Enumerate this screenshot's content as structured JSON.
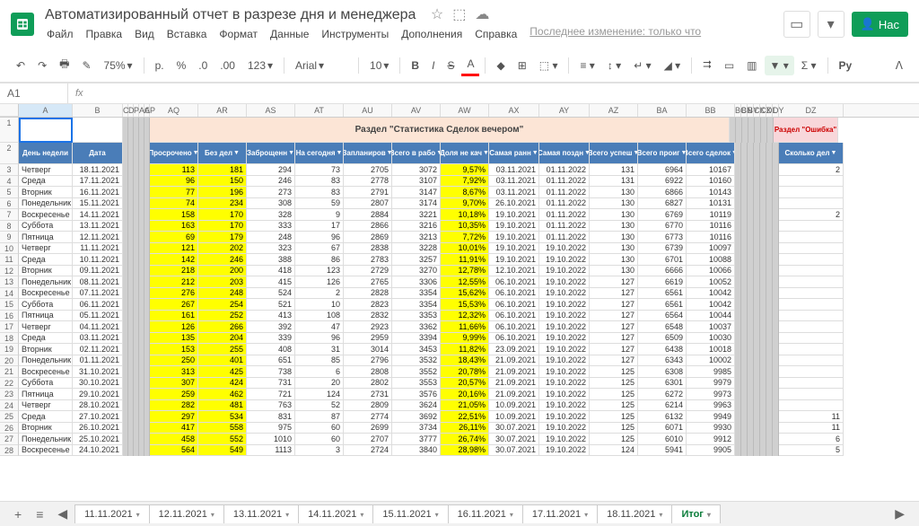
{
  "doc": {
    "title": "Автоматизированный отчет в разрезе дня и менеджера",
    "last_modified": "Последнее изменение: только что"
  },
  "menus": [
    "Файл",
    "Правка",
    "Вид",
    "Вставка",
    "Формат",
    "Данные",
    "Инструменты",
    "Дополнения",
    "Справка"
  ],
  "toolbar": {
    "zoom": "75%",
    "currency": "р.",
    "percent": "%",
    "decimals_dec": ".0",
    "decimals_inc": ".00",
    "format": "123",
    "font": "Arial",
    "fontsize": "10"
  },
  "cell_reference": "A1",
  "share": "Нас",
  "section_header": "Раздел \"Статистика Сделок вечером\"",
  "error_header": "Раздел \"Ошибка\"",
  "columns": {
    "A": "День недели",
    "B": "Дата",
    "AQ": "Просрочено",
    "AR": "Без дел",
    "AS": "Заброщенн",
    "AT": "На сегодня",
    "AU": "Запланиров",
    "AV": "Всего в рабо",
    "AW": "Доля не кач",
    "AX": "Самая ранн",
    "AY": "Самая поздн",
    "AZ": "Всего успеш",
    "BA": "Всего проиг",
    "BB": "Всего сделок",
    "DZ": "Сколько дел"
  },
  "col_letters_small": [
    "C",
    "D",
    "P",
    "AC",
    "AP"
  ],
  "col_letters_small2": [
    "BC",
    "BN",
    "BY",
    "CK",
    "CX",
    "DL",
    "DY"
  ],
  "rows": [
    {
      "n": 3,
      "day": "Четверг",
      "date": "18.11.2021",
      "aq": 113,
      "ar": 181,
      "as": 294,
      "at": 73,
      "au": 2705,
      "av": 3072,
      "aw": "9,57%",
      "ax": "03.11.2021",
      "ay": "01.11.2022",
      "az": 131,
      "ba": 6964,
      "bb": 10167,
      "dz": 2
    },
    {
      "n": 4,
      "day": "Среда",
      "date": "17.11.2021",
      "aq": 96,
      "ar": 150,
      "as": 246,
      "at": 83,
      "au": 2778,
      "av": 3107,
      "aw": "7,92%",
      "ax": "03.11.2021",
      "ay": "01.11.2022",
      "az": 131,
      "ba": 6922,
      "bb": 10160,
      "dz": ""
    },
    {
      "n": 5,
      "day": "Вторник",
      "date": "16.11.2021",
      "aq": 77,
      "ar": 196,
      "as": 273,
      "at": 83,
      "au": 2791,
      "av": 3147,
      "aw": "8,67%",
      "ax": "03.11.2021",
      "ay": "01.11.2022",
      "az": 130,
      "ba": 6866,
      "bb": 10143,
      "dz": ""
    },
    {
      "n": 6,
      "day": "Понедельник",
      "date": "15.11.2021",
      "aq": 74,
      "ar": 234,
      "as": 308,
      "at": 59,
      "au": 2807,
      "av": 3174,
      "aw": "9,70%",
      "ax": "26.10.2021",
      "ay": "01.11.2022",
      "az": 130,
      "ba": 6827,
      "bb": 10131,
      "dz": ""
    },
    {
      "n": 7,
      "day": "Воскресенье",
      "date": "14.11.2021",
      "aq": 158,
      "ar": 170,
      "as": 328,
      "at": 9,
      "au": 2884,
      "av": 3221,
      "aw": "10,18%",
      "ax": "19.10.2021",
      "ay": "01.11.2022",
      "az": 130,
      "ba": 6769,
      "bb": 10119,
      "dz": 2
    },
    {
      "n": 8,
      "day": "Суббота",
      "date": "13.11.2021",
      "aq": 163,
      "ar": 170,
      "as": 333,
      "at": 17,
      "au": 2866,
      "av": 3216,
      "aw": "10,35%",
      "ax": "19.10.2021",
      "ay": "01.11.2022",
      "az": 130,
      "ba": 6770,
      "bb": 10116,
      "dz": ""
    },
    {
      "n": 9,
      "day": "Пятница",
      "date": "12.11.2021",
      "aq": 69,
      "ar": 179,
      "as": 248,
      "at": 96,
      "au": 2869,
      "av": 3213,
      "aw": "7,72%",
      "ax": "19.10.2021",
      "ay": "01.11.2022",
      "az": 130,
      "ba": 6773,
      "bb": 10116,
      "dz": ""
    },
    {
      "n": 10,
      "day": "Четверг",
      "date": "11.11.2021",
      "aq": 121,
      "ar": 202,
      "as": 323,
      "at": 67,
      "au": 2838,
      "av": 3228,
      "aw": "10,01%",
      "ax": "19.10.2021",
      "ay": "19.10.2022",
      "az": 130,
      "ba": 6739,
      "bb": 10097,
      "dz": ""
    },
    {
      "n": 11,
      "day": "Среда",
      "date": "10.11.2021",
      "aq": 142,
      "ar": 246,
      "as": 388,
      "at": 86,
      "au": 2783,
      "av": 3257,
      "aw": "11,91%",
      "ax": "19.10.2021",
      "ay": "19.10.2022",
      "az": 130,
      "ba": 6701,
      "bb": 10088,
      "dz": ""
    },
    {
      "n": 12,
      "day": "Вторник",
      "date": "09.11.2021",
      "aq": 218,
      "ar": 200,
      "as": 418,
      "at": 123,
      "au": 2729,
      "av": 3270,
      "aw": "12,78%",
      "ax": "12.10.2021",
      "ay": "19.10.2022",
      "az": 130,
      "ba": 6666,
      "bb": 10066,
      "dz": ""
    },
    {
      "n": 13,
      "day": "Понедельник",
      "date": "08.11.2021",
      "aq": 212,
      "ar": 203,
      "as": 415,
      "at": 126,
      "au": 2765,
      "av": 3306,
      "aw": "12,55%",
      "ax": "06.10.2021",
      "ay": "19.10.2022",
      "az": 127,
      "ba": 6619,
      "bb": 10052,
      "dz": ""
    },
    {
      "n": 14,
      "day": "Воскресенье",
      "date": "07.11.2021",
      "aq": 276,
      "ar": 248,
      "as": 524,
      "at": 2,
      "au": 2828,
      "av": 3354,
      "aw": "15,62%",
      "ax": "06.10.2021",
      "ay": "19.10.2022",
      "az": 127,
      "ba": 6561,
      "bb": 10042,
      "dz": ""
    },
    {
      "n": 15,
      "day": "Суббота",
      "date": "06.11.2021",
      "aq": 267,
      "ar": 254,
      "as": 521,
      "at": 10,
      "au": 2823,
      "av": 3354,
      "aw": "15,53%",
      "ax": "06.10.2021",
      "ay": "19.10.2022",
      "az": 127,
      "ba": 6561,
      "bb": 10042,
      "dz": ""
    },
    {
      "n": 16,
      "day": "Пятница",
      "date": "05.11.2021",
      "aq": 161,
      "ar": 252,
      "as": 413,
      "at": 108,
      "au": 2832,
      "av": 3353,
      "aw": "12,32%",
      "ax": "06.10.2021",
      "ay": "19.10.2022",
      "az": 127,
      "ba": 6564,
      "bb": 10044,
      "dz": ""
    },
    {
      "n": 17,
      "day": "Четверг",
      "date": "04.11.2021",
      "aq": 126,
      "ar": 266,
      "as": 392,
      "at": 47,
      "au": 2923,
      "av": 3362,
      "aw": "11,66%",
      "ax": "06.10.2021",
      "ay": "19.10.2022",
      "az": 127,
      "ba": 6548,
      "bb": 10037,
      "dz": ""
    },
    {
      "n": 18,
      "day": "Среда",
      "date": "03.11.2021",
      "aq": 135,
      "ar": 204,
      "as": 339,
      "at": 96,
      "au": 2959,
      "av": 3394,
      "aw": "9,99%",
      "ax": "06.10.2021",
      "ay": "19.10.2022",
      "az": 127,
      "ba": 6509,
      "bb": 10030,
      "dz": ""
    },
    {
      "n": 19,
      "day": "Вторник",
      "date": "02.11.2021",
      "aq": 153,
      "ar": 255,
      "as": 408,
      "at": 31,
      "au": 3014,
      "av": 3453,
      "aw": "11,82%",
      "ax": "23.09.2021",
      "ay": "19.10.2022",
      "az": 127,
      "ba": 6438,
      "bb": 10018,
      "dz": ""
    },
    {
      "n": 20,
      "day": "Понедельник",
      "date": "01.11.2021",
      "aq": 250,
      "ar": 401,
      "as": 651,
      "at": 85,
      "au": 2796,
      "av": 3532,
      "aw": "18,43%",
      "ax": "21.09.2021",
      "ay": "19.10.2022",
      "az": 127,
      "ba": 6343,
      "bb": 10002,
      "dz": ""
    },
    {
      "n": 21,
      "day": "Воскресенье",
      "date": "31.10.2021",
      "aq": 313,
      "ar": 425,
      "as": 738,
      "at": 6,
      "au": 2808,
      "av": 3552,
      "aw": "20,78%",
      "ax": "21.09.2021",
      "ay": "19.10.2022",
      "az": 125,
      "ba": 6308,
      "bb": 9985,
      "dz": ""
    },
    {
      "n": 22,
      "day": "Суббота",
      "date": "30.10.2021",
      "aq": 307,
      "ar": 424,
      "as": 731,
      "at": 20,
      "au": 2802,
      "av": 3553,
      "aw": "20,57%",
      "ax": "21.09.2021",
      "ay": "19.10.2022",
      "az": 125,
      "ba": 6301,
      "bb": 9979,
      "dz": ""
    },
    {
      "n": 23,
      "day": "Пятница",
      "date": "29.10.2021",
      "aq": 259,
      "ar": 462,
      "as": 721,
      "at": 124,
      "au": 2731,
      "av": 3576,
      "aw": "20,16%",
      "ax": "21.09.2021",
      "ay": "19.10.2022",
      "az": 125,
      "ba": 6272,
      "bb": 9973,
      "dz": ""
    },
    {
      "n": 24,
      "day": "Четверг",
      "date": "28.10.2021",
      "aq": 282,
      "ar": 481,
      "as": 763,
      "at": 52,
      "au": 2809,
      "av": 3624,
      "aw": "21,05%",
      "ax": "10.09.2021",
      "ay": "19.10.2022",
      "az": 125,
      "ba": 6214,
      "bb": 9963,
      "dz": ""
    },
    {
      "n": 25,
      "day": "Среда",
      "date": "27.10.2021",
      "aq": 297,
      "ar": 534,
      "as": 831,
      "at": 87,
      "au": 2774,
      "av": 3692,
      "aw": "22,51%",
      "ax": "10.09.2021",
      "ay": "19.10.2022",
      "az": 125,
      "ba": 6132,
      "bb": 9949,
      "dz": 11
    },
    {
      "n": 26,
      "day": "Вторник",
      "date": "26.10.2021",
      "aq": 417,
      "ar": 558,
      "as": 975,
      "at": 60,
      "au": 2699,
      "av": 3734,
      "aw": "26,11%",
      "ax": "30.07.2021",
      "ay": "19.10.2022",
      "az": 125,
      "ba": 6071,
      "bb": 9930,
      "dz": 11
    },
    {
      "n": 27,
      "day": "Понедельник",
      "date": "25.10.2021",
      "aq": 458,
      "ar": 552,
      "as": 1010,
      "at": 60,
      "au": 2707,
      "av": 3777,
      "aw": "26,74%",
      "ax": "30.07.2021",
      "ay": "19.10.2022",
      "az": 125,
      "ba": 6010,
      "bb": 9912,
      "dz": 6
    },
    {
      "n": 28,
      "day": "Воскресенье",
      "date": "24.10.2021",
      "aq": 564,
      "ar": 549,
      "as": 1113,
      "at": 3,
      "au": 2724,
      "av": 3840,
      "aw": "28,98%",
      "ax": "30.07.2021",
      "ay": "19.10.2022",
      "az": 124,
      "ba": 5941,
      "bb": 9905,
      "dz": 5
    }
  ],
  "tabs": [
    "11.11.2021",
    "12.11.2021",
    "13.11.2021",
    "14.11.2021",
    "15.11.2021",
    "16.11.2021",
    "17.11.2021",
    "18.11.2021",
    "Итог"
  ]
}
